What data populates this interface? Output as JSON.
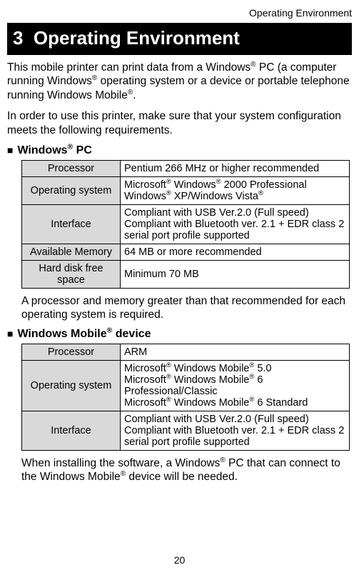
{
  "running_head": "Operating Environment",
  "chapter": {
    "number": "3",
    "title": "Operating Environment"
  },
  "intro1_html": "This mobile printer can print data from a Windows<sup>®</sup> PC (a computer running Windows<sup>®</sup> operating system or a device or portable telephone running Windows Mobile<sup>®</sup>.",
  "intro2": "In order to use this printer, make sure that your system configuration meets the following requirements.",
  "section1": {
    "heading_html": "Windows<sup>®</sup> PC",
    "rows": [
      {
        "label": "Processor",
        "value_html": "Pentium 266 MHz or higher recommended"
      },
      {
        "label": "Operating system",
        "value_html": "Microsoft<sup>®</sup> Windows<sup>®</sup> 2000 Professional Windows<sup>®</sup> XP/Windows Vista<sup>®</sup>"
      },
      {
        "label": "Interface",
        "value_html": "Compliant with USB Ver.2.0 (Full speed)<br>Compliant with Bluetooth ver. 2.1 + EDR class 2 serial port profile supported"
      },
      {
        "label": "Available Memory",
        "value_html": "64 MB or more recommended"
      },
      {
        "label": "Hard disk free space",
        "value_html": "Minimum 70 MB"
      }
    ],
    "note": "A processor and memory greater than that recommended for each operating system is required."
  },
  "section2": {
    "heading_html": "Windows Mobile<sup>®</sup> device",
    "rows": [
      {
        "label": "Processor",
        "value_html": "ARM"
      },
      {
        "label": "Operating system",
        "value_html": "Microsoft<sup>®</sup> Windows Mobile<sup>®</sup> 5.0<br>Microsoft<sup>®</sup> Windows Mobile<sup>®</sup> 6 Professional/Classic<br>Microsoft<sup>®</sup> Windows Mobile<sup>®</sup> 6 Standard"
      },
      {
        "label": "Interface",
        "value_html": "Compliant with USB Ver.2.0 (Full speed)<br>Compliant with Bluetooth ver. 2.1 + EDR class 2 serial port profile supported"
      }
    ],
    "note_html": "When installing the software, a Windows<sup>®</sup> PC that can connect to the Windows Mobile<sup>®</sup> device will be needed."
  },
  "page_number": "20"
}
